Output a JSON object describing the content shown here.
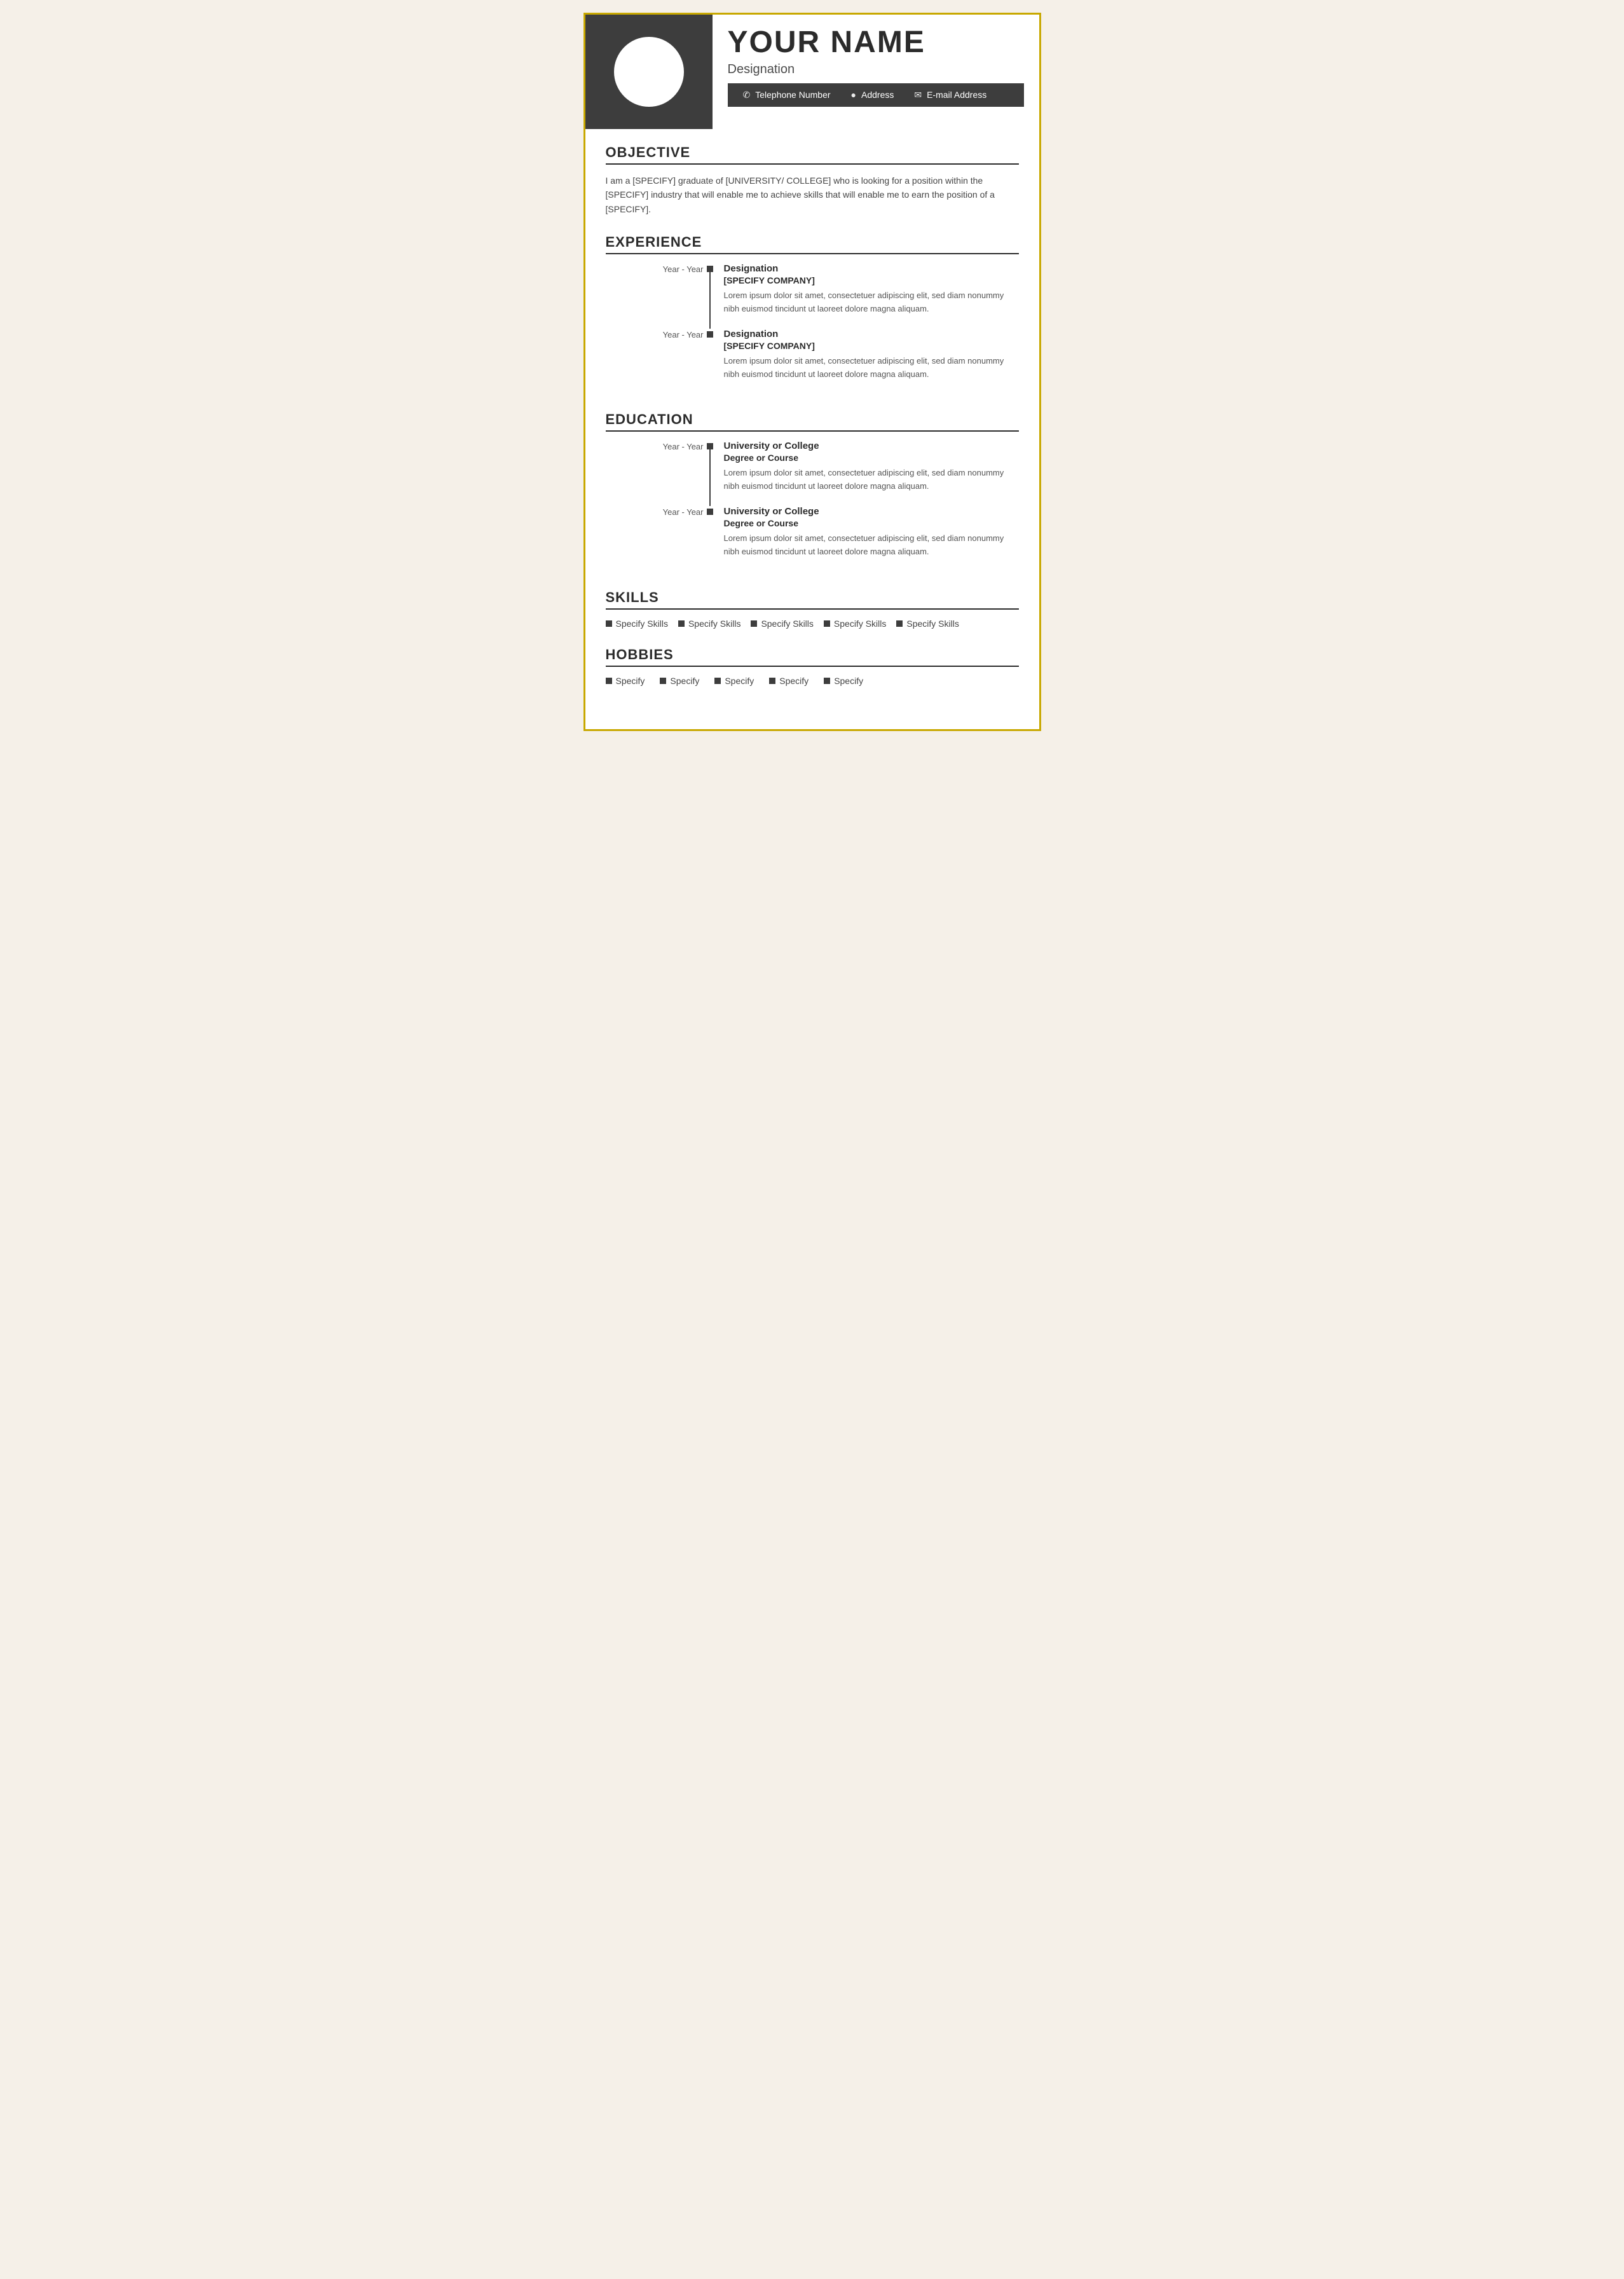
{
  "header": {
    "name": "YOUR NAME",
    "designation": "Designation",
    "contact": {
      "phone": "Telephone Number",
      "address": "Address",
      "email": "E-mail Address"
    }
  },
  "objective": {
    "title": "OBJECTIVE",
    "text": "I am a [SPECIFY] graduate of [UNIVERSITY/ COLLEGE] who is looking for a position within the [SPECIFY] industry that will enable me to achieve skills that will enable me to earn the position of a [SPECIFY]."
  },
  "experience": {
    "title": "EXPERIENCE",
    "entries": [
      {
        "years": "Year - Year",
        "designation": "Designation",
        "company": "[SPECIFY COMPANY]",
        "description": "Lorem ipsum dolor sit amet, consectetuer adipiscing elit, sed diam nonummy nibh euismod tincidunt ut laoreet dolore magna aliquam."
      },
      {
        "years": "Year - Year",
        "designation": "Designation",
        "company": "[SPECIFY COMPANY]",
        "description": "Lorem ipsum dolor sit amet, consectetuer adipiscing elit, sed diam nonummy nibh euismod tincidunt ut laoreet dolore magna aliquam."
      }
    ]
  },
  "education": {
    "title": "EDUCATION",
    "entries": [
      {
        "years": "Year - Year",
        "institution": "University or College",
        "degree": "Degree or Course",
        "description": "Lorem ipsum dolor sit amet, consectetuer adipiscing elit, sed diam nonummy nibh euismod tincidunt ut laoreet dolore magna aliquam."
      },
      {
        "years": "Year - Year",
        "institution": "University or College",
        "degree": "Degree or Course",
        "description": "Lorem ipsum dolor sit amet, consectetuer adipiscing elit, sed diam nonummy nibh euismod tincidunt ut laoreet dolore magna aliquam."
      }
    ]
  },
  "skills": {
    "title": "SKILLS",
    "items": [
      "Specify Skills",
      "Specify Skills",
      "Specify Skills",
      "Specify Skills",
      "Specify Skills"
    ]
  },
  "hobbies": {
    "title": "HOBBIES",
    "items": [
      "Specify",
      "Specify",
      "Specify",
      "Specify",
      "Specify"
    ]
  },
  "icons": {
    "phone": "📞",
    "address": "📍",
    "email": "✉"
  }
}
